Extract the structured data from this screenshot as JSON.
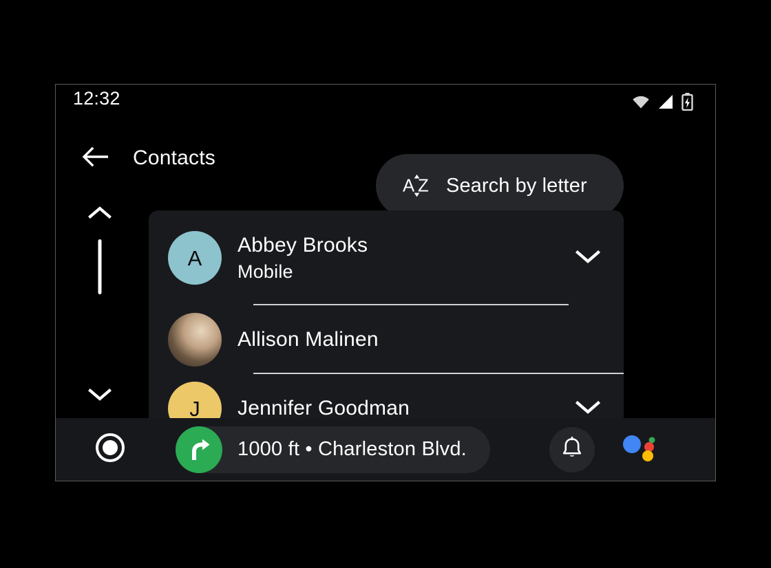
{
  "status_bar": {
    "clock": "12:32",
    "icons": [
      {
        "name": "wifi-icon",
        "label": "wifi"
      },
      {
        "name": "cellular-signal-icon",
        "label": "signal"
      },
      {
        "name": "battery-charging-icon",
        "label": "battery charging"
      }
    ]
  },
  "header": {
    "back_icon": "arrow-back-icon",
    "title": "Contacts",
    "search_by_letter": {
      "icon": "sort-alphabetical-icon",
      "icon_letters": {
        "first": "A",
        "second": "Z"
      },
      "label": "Search by letter"
    }
  },
  "scrollbar": {
    "up_icon": "chevron-up-icon",
    "down_icon": "chevron-down-icon"
  },
  "contacts": [
    {
      "name": "Abbey Brooks",
      "subtitle": "Mobile",
      "avatar_type": "initial",
      "avatar_initial": "A",
      "avatar_color": "#8cc3cd",
      "has_expand": true,
      "expand_icon": "chevron-down-icon"
    },
    {
      "name": "Allison Malinen",
      "subtitle": "",
      "avatar_type": "photo",
      "avatar_initial": "",
      "avatar_color": "#c9ab86",
      "has_expand": false,
      "expand_icon": ""
    },
    {
      "name": "Jennifer Goodman",
      "subtitle": "",
      "avatar_type": "initial",
      "avatar_initial": "J",
      "avatar_color": "#ecc868",
      "has_expand": true,
      "expand_icon": "chevron-down-icon"
    }
  ],
  "bottom_bar": {
    "home_icon": "home-circle-icon",
    "navigation": {
      "icon": "turn-right-icon",
      "icon_color": "#2bab54",
      "label": "1000 ft • Charleston Blvd."
    },
    "notifications_icon": "bell-icon",
    "assistant_icon": "google-assistant-icon",
    "assistant_colors": {
      "blue": "#4285f4",
      "red": "#ea4335",
      "yellow": "#fbbc05",
      "green": "#34a853"
    }
  },
  "theme": {
    "background": "#000000",
    "panel": "#191a1e",
    "bottom_bar": "#17181c",
    "pill": "#26272b",
    "text": "#ffffff",
    "divider": "#cfd2d6"
  }
}
